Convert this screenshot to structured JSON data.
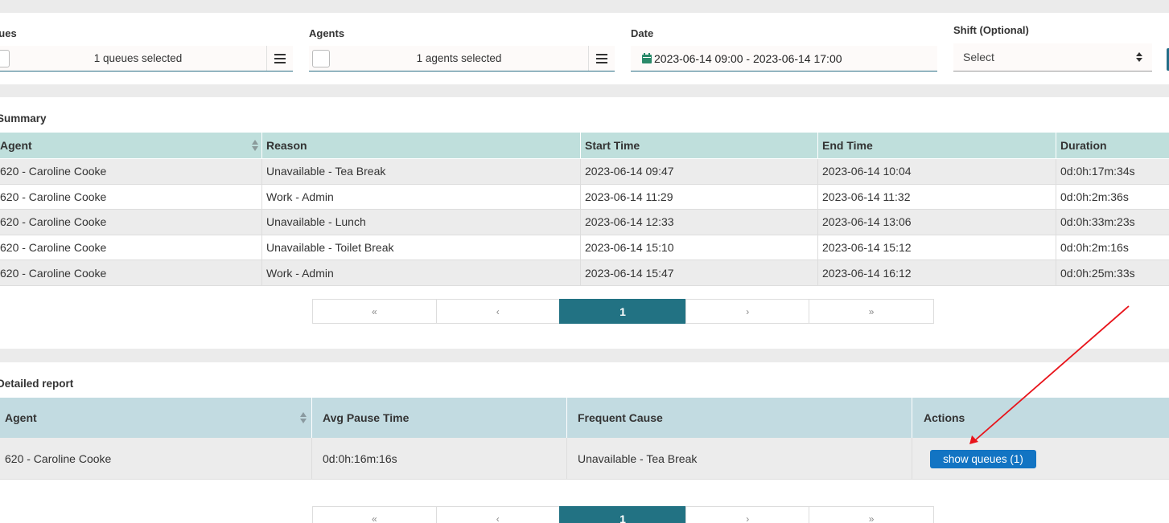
{
  "filters": {
    "queues": {
      "label": "Queues",
      "value": "1 queues selected"
    },
    "agents": {
      "label": "Agents",
      "value": "1 agents selected"
    },
    "date": {
      "label": "Date",
      "value": "2023-06-14 09:00 - 2023-06-14 17:00"
    },
    "shift": {
      "label": "Shift (Optional)",
      "placeholder": "Select"
    }
  },
  "summary": {
    "title": "Summary",
    "columns": [
      "Agent",
      "Reason",
      "Start Time",
      "End Time",
      "Duration"
    ],
    "rows": [
      [
        "620 - Caroline Cooke",
        "Unavailable - Tea Break",
        "2023-06-14 09:47",
        "2023-06-14 10:04",
        "0d:0h:17m:34s"
      ],
      [
        "620 - Caroline Cooke",
        "Work - Admin",
        "2023-06-14 11:29",
        "2023-06-14 11:32",
        "0d:0h:2m:36s"
      ],
      [
        "620 - Caroline Cooke",
        "Unavailable - Lunch",
        "2023-06-14 12:33",
        "2023-06-14 13:06",
        "0d:0h:33m:23s"
      ],
      [
        "620 - Caroline Cooke",
        "Unavailable - Toilet Break",
        "2023-06-14 15:10",
        "2023-06-14 15:12",
        "0d:0h:2m:16s"
      ],
      [
        "620 - Caroline Cooke",
        "Work - Admin",
        "2023-06-14 15:47",
        "2023-06-14 16:12",
        "0d:0h:25m:33s"
      ]
    ]
  },
  "pagination": {
    "first": "«",
    "prev": "‹",
    "current": "1",
    "next": "›",
    "last": "»"
  },
  "detailed": {
    "title": "Detailed report",
    "columns": [
      "Agent",
      "Avg Pause Time",
      "Frequent Cause",
      "Actions"
    ],
    "rows": [
      {
        "agent": "620 - Caroline Cooke",
        "avg_pause": "0d:0h:16m:16s",
        "cause": "Unavailable - Tea Break",
        "action_label": "show queues (1)"
      }
    ]
  },
  "colors": {
    "summary_header": "#bfdfdc",
    "detail_header": "#c2dbe1",
    "active_page": "#227283",
    "action_button": "#1274c3",
    "annotation_arrow": "#e8141b"
  },
  "icons": {
    "calendar": "calendar-icon",
    "menu": "hamburger-icon",
    "sort": "sort-icon",
    "select": "select-arrows-icon"
  }
}
